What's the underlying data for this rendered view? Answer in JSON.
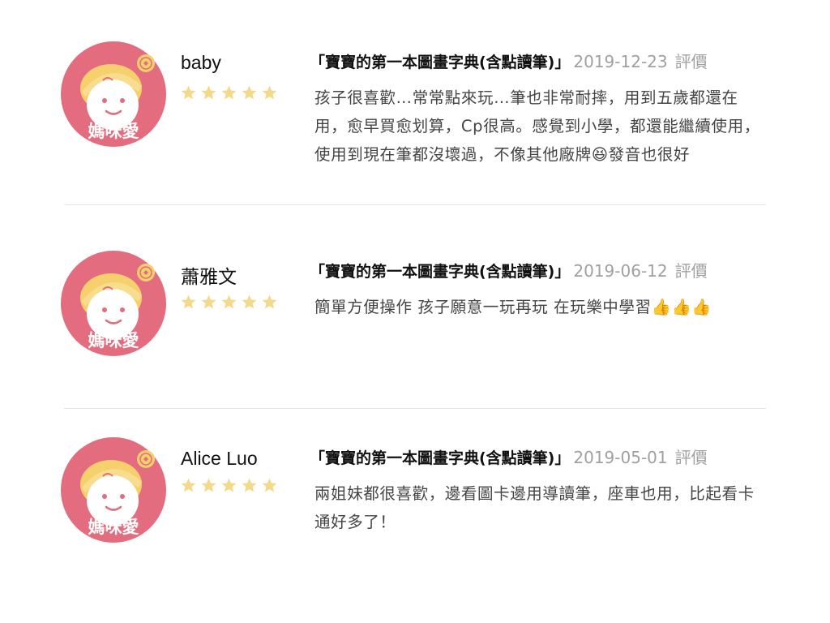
{
  "colors": {
    "avatar_bg": "#e36d7e",
    "star": "#f3d98a",
    "date_text": "#a0a0a0",
    "divider": "#e3e3e3"
  },
  "avatar": {
    "brand_text": "媽咪愛",
    "icon": "baby-face-logo-icon"
  },
  "reviews": [
    {
      "name": "baby",
      "stars": 5,
      "product": "「寶寶的第一本圖畫字典(含點讀筆)」",
      "date": "2019-12-23",
      "rating_label": "評價",
      "text": "孩子很喜歡…常常點來玩…筆也非常耐摔，用到五歲都還在用，愈早買愈划算，Cp很高。感覺到小學，都還能繼續使用，使用到現在筆都沒壞過，不像其他廠牌😆發音也很好"
    },
    {
      "name": "蕭雅文",
      "stars": 5,
      "product": "「寶寶的第一本圖畫字典(含點讀筆)」",
      "date": "2019-06-12",
      "rating_label": "評價",
      "text": "簡單方便操作  孩子願意一玩再玩  在玩樂中學習👍👍👍"
    },
    {
      "name": "Alice Luo",
      "stars": 5,
      "product": "「寶寶的第一本圖畫字典(含點讀筆)」",
      "date": "2019-05-01",
      "rating_label": "評價",
      "text": "兩姐妹都很喜歡，邊看圖卡邊用導讀筆，座車也用，比起看卡通好多了！"
    }
  ]
}
